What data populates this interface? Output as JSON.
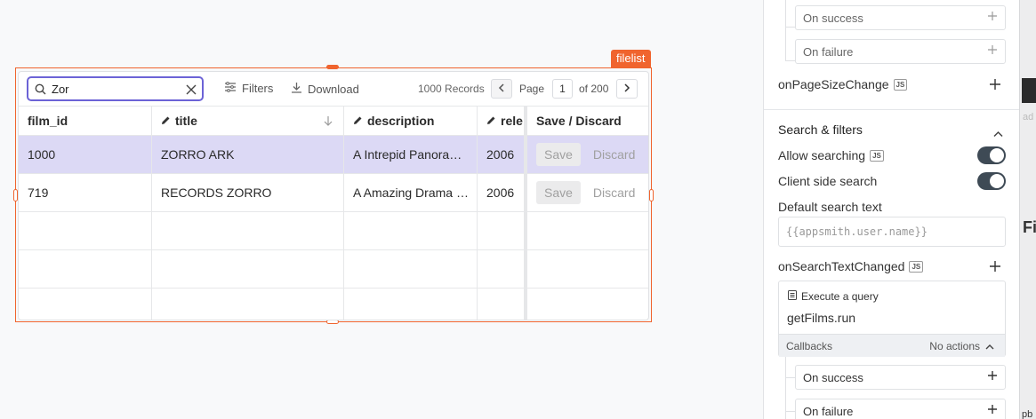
{
  "widget": {
    "name": "filelist"
  },
  "table": {
    "search": {
      "value": "Zor"
    },
    "toolbar": {
      "filters_label": "Filters",
      "download_label": "Download"
    },
    "pagination": {
      "records_label": "1000 Records",
      "page_label": "Page",
      "current_page": "1",
      "of_label": "of 200"
    },
    "columns": [
      {
        "label": "film_id",
        "editable": false
      },
      {
        "label": "title",
        "editable": true,
        "sorted": "desc"
      },
      {
        "label": "description",
        "editable": true
      },
      {
        "label": "rele",
        "editable": true
      },
      {
        "label": "Save / Discard",
        "editable": false
      }
    ],
    "rows": [
      {
        "film_id": "1000",
        "title": "ZORRO ARK",
        "description": "A Intrepid Panorama of a Mad Scientist",
        "release": "2006",
        "save": "Save",
        "discard": "Discard",
        "selected": true
      },
      {
        "film_id": "719",
        "title": "RECORDS ZORRO",
        "description": "A Amazing Drama of a Mad Scientist",
        "release": "2006",
        "save": "Save",
        "discard": "Discard",
        "selected": false
      }
    ]
  },
  "panel": {
    "top_callbacks": {
      "on_success": "On success",
      "on_failure": "On failure"
    },
    "on_page_size_change": "onPageSizeChange",
    "js_badge": "JS",
    "search_section": {
      "title": "Search & filters",
      "allow_searching": "Allow searching",
      "client_side_search": "Client side search",
      "default_search_label": "Default search text",
      "default_search_placeholder": "{{appsmith.user.name}}",
      "on_search_text_changed": "onSearchTextChanged",
      "action": {
        "type_label": "Execute a query",
        "query": "getFilms.run"
      },
      "callbacks": {
        "label": "Callbacks",
        "value": "No actions"
      },
      "on_success": "On success",
      "on_failure": "On failure"
    },
    "edge_fragments": {
      "frag1": "ad",
      "frag2": "File",
      "frag3": "pb"
    }
  },
  "colors": {
    "accent": "#f0642e",
    "selection": "#dcd9f5",
    "search_focus": "#6c63d6",
    "toggle_on": "#3e4a55"
  }
}
